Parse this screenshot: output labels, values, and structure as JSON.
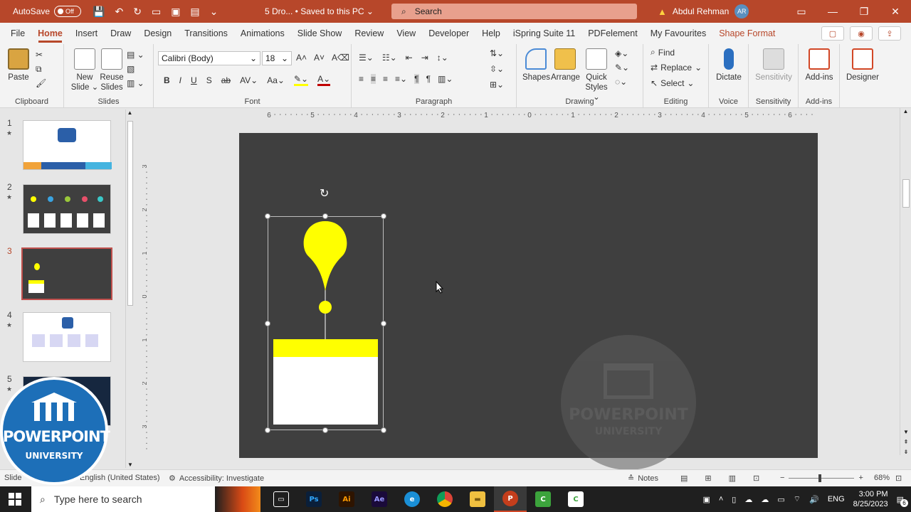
{
  "titlebar": {
    "autosave": "AutoSave",
    "toggle": "Off",
    "doc_title": "5 Dro... • Saved to this PC ⌄",
    "search": "Search",
    "user": "Abdul Rehman",
    "initials": "AR"
  },
  "tabs": [
    "File",
    "Home",
    "Insert",
    "Draw",
    "Design",
    "Transitions",
    "Animations",
    "Slide Show",
    "Review",
    "View",
    "Developer",
    "Help",
    "iSpring Suite 11",
    "PDFelement",
    "My Favourites",
    "Shape Format"
  ],
  "ribbon": {
    "clipboard": {
      "paste": "Paste",
      "label": "Clipboard"
    },
    "slides": {
      "new_slide": "New Slide ⌄",
      "reuse": "Reuse Slides",
      "label": "Slides"
    },
    "font": {
      "name": "Calibri (Body)",
      "size": "18",
      "label": "Font"
    },
    "paragraph": {
      "label": "Paragraph"
    },
    "drawing": {
      "shapes": "Shapes",
      "arrange": "Arrange",
      "quick_styles": "Quick Styles ⌄",
      "label": "Drawing"
    },
    "editing": {
      "find": "Find",
      "replace": "Replace",
      "select": "Select",
      "label": "Editing"
    },
    "voice": {
      "dictate": "Dictate",
      "label": "Voice"
    },
    "sensitivity": {
      "btn": "Sensitivity",
      "label": "Sensitivity"
    },
    "addins": {
      "btn": "Add-ins",
      "label": "Add-ins"
    },
    "designer": {
      "btn": "Designer"
    }
  },
  "thumbnails": [
    {
      "num": "1",
      "star": "★"
    },
    {
      "num": "2",
      "star": "★"
    },
    {
      "num": "3",
      "star": ""
    },
    {
      "num": "4",
      "star": "★"
    },
    {
      "num": "5",
      "star": "★"
    }
  ],
  "ruler": {
    "h": [
      "6",
      "5",
      "4",
      "3",
      "2",
      "1",
      "0",
      "1",
      "2",
      "3",
      "4",
      "5",
      "6"
    ],
    "v": [
      "3",
      "2",
      "1",
      "0",
      "1",
      "2",
      "3"
    ]
  },
  "statusbar": {
    "slide": "Slide",
    "lang": "English (United States)",
    "access": "Accessibility: Investigate",
    "notes": "Notes",
    "zoom": "68%"
  },
  "watermark": {
    "text1": "POWERPOINT",
    "text2": "UNIVERSITY"
  },
  "logo": {
    "text1": "POWERPOINT",
    "text2": "UNIVERSITY"
  },
  "taskbar": {
    "search": "Type here to search",
    "lang": "ENG",
    "time": "3:00 PM",
    "date": "8/25/2023",
    "notif": "6"
  },
  "colors": {
    "accent": "#b7472a",
    "slide_bg": "#3f3f3f",
    "yellow": "#ffff00"
  }
}
